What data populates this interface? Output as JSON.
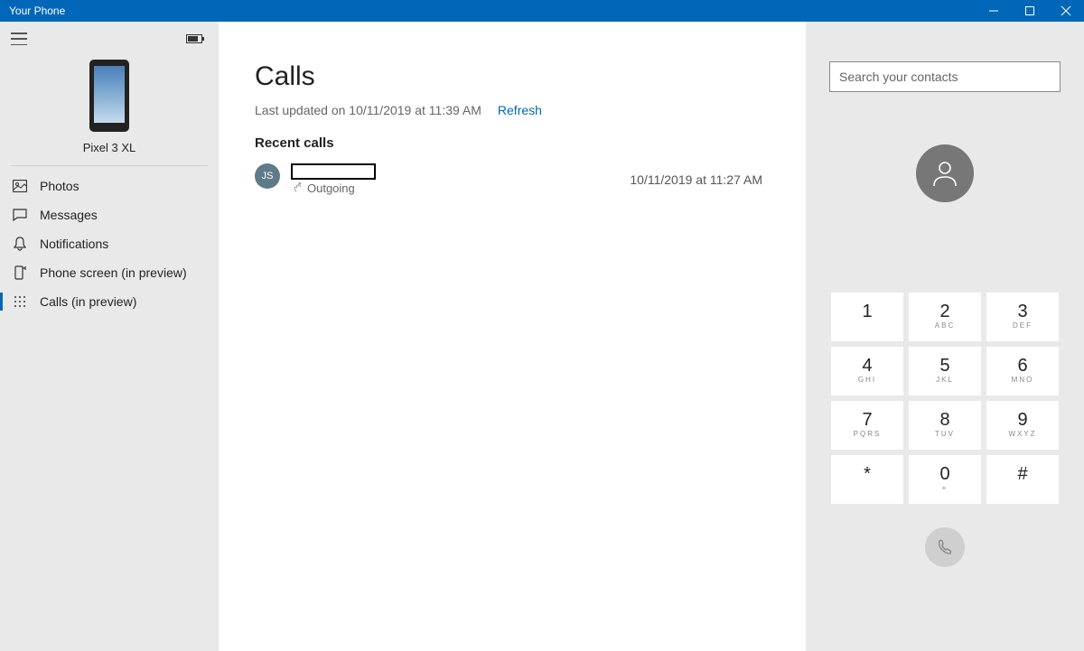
{
  "titlebar": {
    "title": "Your Phone"
  },
  "sidebar": {
    "device_name": "Pixel 3 XL",
    "items": [
      {
        "label": "Photos"
      },
      {
        "label": "Messages"
      },
      {
        "label": "Notifications"
      },
      {
        "label": "Phone screen (in preview)"
      },
      {
        "label": "Calls (in preview)"
      }
    ]
  },
  "main": {
    "title": "Calls",
    "last_updated": "Last updated on 10/11/2019 at 11:39 AM",
    "refresh_label": "Refresh",
    "section_recent": "Recent calls",
    "calls": [
      {
        "initials": "JS",
        "direction": "Outgoing",
        "timestamp": "10/11/2019 at 11:27 AM"
      }
    ]
  },
  "dialer": {
    "search_placeholder": "Search your contacts",
    "keys": [
      {
        "digit": "1",
        "sub": ""
      },
      {
        "digit": "2",
        "sub": "ABC"
      },
      {
        "digit": "3",
        "sub": "DEF"
      },
      {
        "digit": "4",
        "sub": "GHI"
      },
      {
        "digit": "5",
        "sub": "JKL"
      },
      {
        "digit": "6",
        "sub": "MNO"
      },
      {
        "digit": "7",
        "sub": "PQRS"
      },
      {
        "digit": "8",
        "sub": "TUV"
      },
      {
        "digit": "9",
        "sub": "WXYZ"
      },
      {
        "digit": "*",
        "sub": ""
      },
      {
        "digit": "0",
        "sub": "+"
      },
      {
        "digit": "#",
        "sub": ""
      }
    ]
  }
}
